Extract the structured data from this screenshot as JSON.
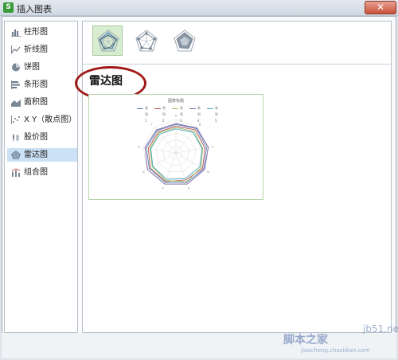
{
  "window": {
    "title": "插入图表",
    "app_icon_letter": "S",
    "close_symbol": "✕"
  },
  "sidebar": {
    "items": [
      {
        "label": "柱形图",
        "icon": "column-chart-icon"
      },
      {
        "label": "折线图",
        "icon": "line-chart-icon"
      },
      {
        "label": "饼图",
        "icon": "pie-chart-icon"
      },
      {
        "label": "条形图",
        "icon": "bar-chart-icon"
      },
      {
        "label": "面积图",
        "icon": "area-chart-icon"
      },
      {
        "label": "X Y（散点图）",
        "icon": "scatter-chart-icon"
      },
      {
        "label": "股价图",
        "icon": "stock-chart-icon"
      },
      {
        "label": "雷达图",
        "icon": "radar-chart-icon",
        "selected": true
      },
      {
        "label": "组合图",
        "icon": "combo-chart-icon"
      }
    ]
  },
  "main": {
    "subtypes": [
      {
        "icon": "radar-subtype-icon",
        "selected": true
      },
      {
        "icon": "radar-markers-subtype-icon",
        "selected": false
      },
      {
        "icon": "filled-radar-subtype-icon",
        "selected": false
      }
    ],
    "section_title": "雷达图",
    "preview": {
      "title": "图表标题",
      "legend": [
        "系列1",
        "系列2",
        "系列3",
        "系列4",
        "系列5"
      ]
    }
  },
  "chart_data": {
    "type": "radar",
    "title": "图表标题",
    "categories": [
      "A",
      "B",
      "C",
      "D",
      "E",
      "F",
      "G",
      "H",
      "I"
    ],
    "rlim": [
      0,
      10
    ],
    "series": [
      {
        "name": "系列1",
        "color": "#4f81bd",
        "values": [
          8.5,
          9.5,
          9.3,
          9.6,
          9.4,
          9.4,
          9.2,
          9.0,
          8.7
        ]
      },
      {
        "name": "系列2",
        "color": "#c0504d",
        "values": [
          8.0,
          9.0,
          8.8,
          9.2,
          8.6,
          9.1,
          8.9,
          8.4,
          8.2
        ]
      },
      {
        "name": "系列3",
        "color": "#9bbb59",
        "values": [
          7.6,
          8.4,
          8.1,
          8.7,
          9.2,
          8.8,
          8.2,
          7.9,
          7.8
        ]
      },
      {
        "name": "系列4",
        "color": "#8064a2",
        "values": [
          8.8,
          9.7,
          9.8,
          9.9,
          9.9,
          9.9,
          9.8,
          9.4,
          9.0
        ]
      },
      {
        "name": "系列5",
        "color": "#4bacc6",
        "values": [
          7.2,
          8.0,
          7.9,
          8.3,
          8.2,
          8.4,
          8.0,
          7.6,
          7.4
        ]
      }
    ]
  },
  "watermark": {
    "top": "jb51.net",
    "main": "脚本之家",
    "bottom": "jiaocheng.chazidian.com"
  }
}
